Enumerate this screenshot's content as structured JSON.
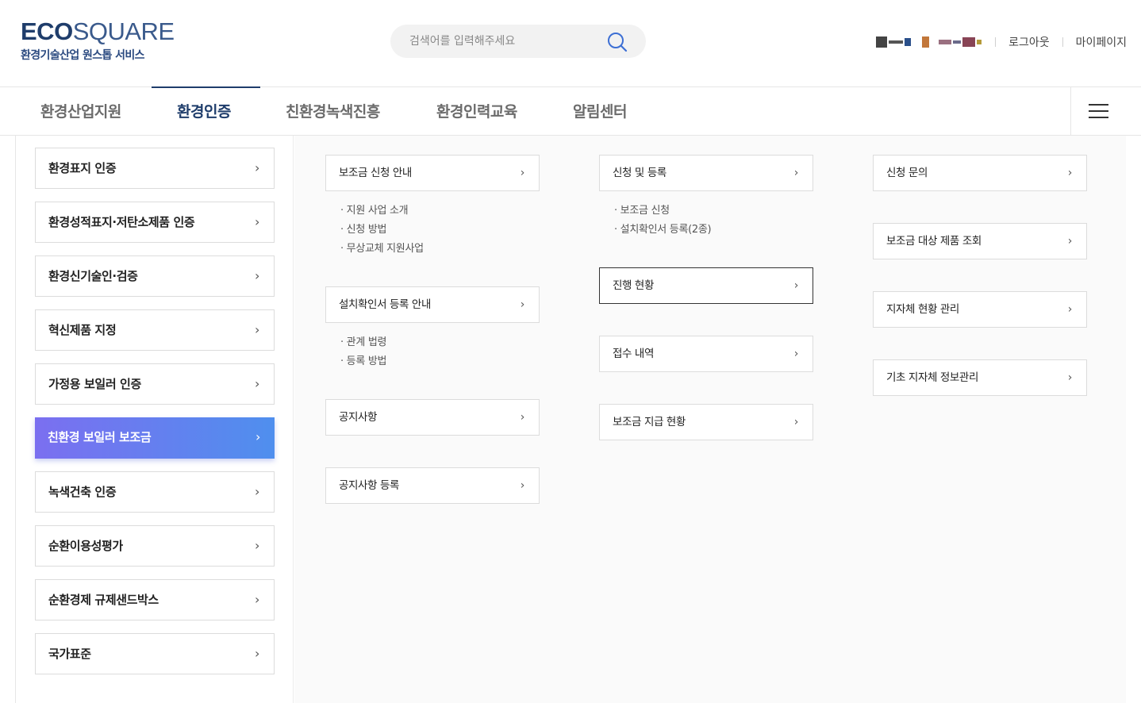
{
  "logo": {
    "eco": "ECO",
    "square": "SQUARE",
    "subtitle": "환경기술산업 원스톱 서비스"
  },
  "search": {
    "placeholder": "검색어를 입력해주세요"
  },
  "user": {
    "logout": "로그아웃",
    "mypage": "마이페이지"
  },
  "gnb": {
    "items": [
      "환경산업지원",
      "환경인증",
      "친환경녹색진흥",
      "환경인력교육",
      "알림센터"
    ],
    "active_index": 1
  },
  "sidebar": {
    "items": [
      "환경표지 인증",
      "환경성적표지·저탄소제품 인증",
      "환경신기술인·검증",
      "혁신제품 지정",
      "가정용 보일러 인증",
      "친환경 보일러 보조금",
      "녹색건축 인증",
      "순환이용성평가",
      "순환경제 규제샌드박스",
      "국가표준"
    ],
    "active_index": 5
  },
  "submenu": {
    "col1": {
      "subsidy_guide": "보조금 신청 안내",
      "subsidy_guide_links": [
        "지원 사업 소개",
        "신청 방법",
        "무상교체 지원사업"
      ],
      "install_guide": "설치확인서 등록 안내",
      "install_guide_links": [
        "관계 법령",
        "등록 방법"
      ],
      "notice": "공지사항",
      "notice_register": "공지사항 등록"
    },
    "col2": {
      "apply_register": "신청 및 등록",
      "apply_register_links": [
        "보조금 신청",
        "설치확인서 등록(2종)"
      ],
      "progress": "진행 현황",
      "receipt": "접수 내역",
      "payment": "보조금 지급 현황"
    },
    "col3": {
      "inquiry": "신청 문의",
      "target_products": "보조금 대상 제품 조회",
      "local_gov": "지자체 현황 관리",
      "basic_local_gov": "기초 지자체 정보관리"
    }
  },
  "chevron": "›",
  "colors": {
    "brand": "#1f3d6b",
    "active_gradient_start": "#7b6ff0",
    "active_gradient_end": "#4f8fee"
  }
}
